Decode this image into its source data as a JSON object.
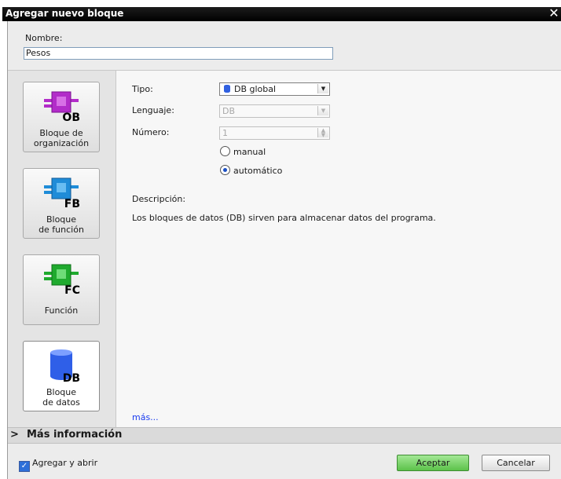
{
  "window": {
    "title": "Agregar nuevo bloque",
    "close": "✕"
  },
  "name": {
    "label": "Nombre:",
    "value": "Pesos"
  },
  "blocks": [
    {
      "label": "Bloque de\norganización",
      "badge": "OB",
      "color": "#b22cc9"
    },
    {
      "label": "Bloque\nde función",
      "badge": "FB",
      "color": "#1f8cd8"
    },
    {
      "label": "Función",
      "badge": "FC",
      "color": "#1faa2e"
    },
    {
      "label": "Bloque\nde datos",
      "badge": "DB",
      "color": "#2f5fe8"
    }
  ],
  "form": {
    "tipo_label": "Tipo:",
    "tipo_value": "DB global",
    "lenguaje_label": "Lenguaje:",
    "lenguaje_value": "DB",
    "numero_label": "Número:",
    "numero_value": "1",
    "manual_label": "manual",
    "automatico_label": "automático",
    "selected_mode": "automático"
  },
  "description": {
    "label": "Descripción:",
    "text": "Los bloques de datos (DB) sirven para almacenar datos del programa."
  },
  "more_link": "más...",
  "more_info": {
    "chevron": ">",
    "label": "Más información"
  },
  "footer": {
    "add_open_label": "Agregar y abrir",
    "add_open_checked": true,
    "ok_label": "Aceptar",
    "cancel_label": "Cancelar"
  },
  "colors": {
    "accept_green": "#5cc24a",
    "radio_blue": "#1a4fc4",
    "link_blue": "#1a3cf0"
  }
}
